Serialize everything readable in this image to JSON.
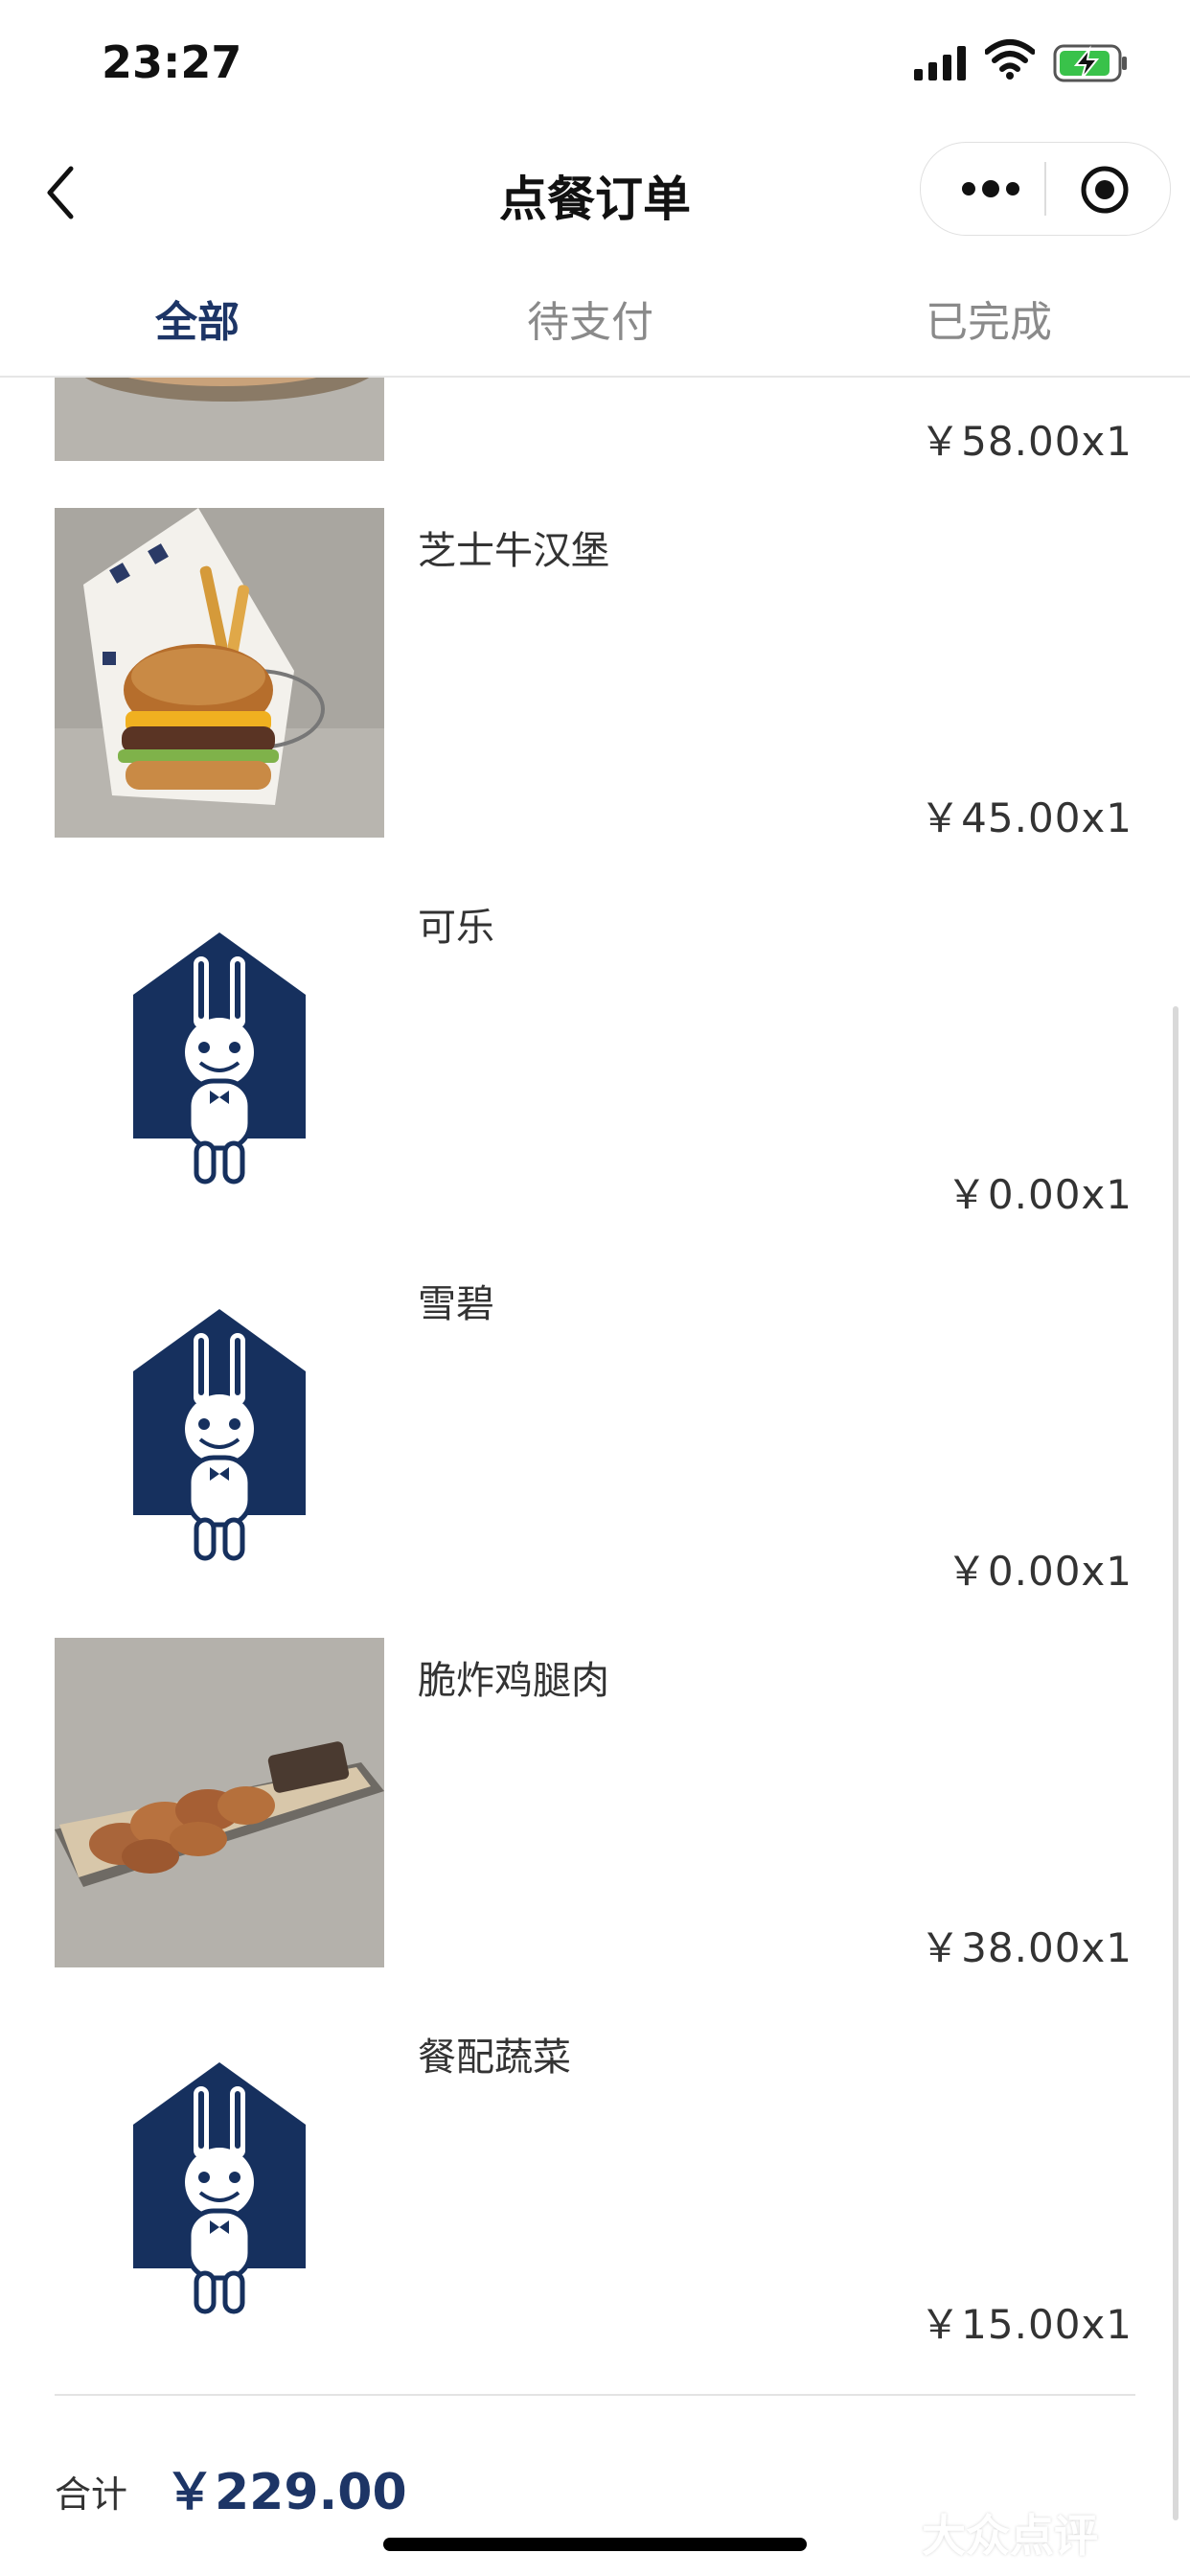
{
  "status_bar": {
    "time": "23:27"
  },
  "navbar": {
    "title": "点餐订单"
  },
  "tabs": [
    {
      "label": "全部",
      "active": true
    },
    {
      "label": "待支付",
      "active": false
    },
    {
      "label": "已完成",
      "active": false
    }
  ],
  "items": [
    {
      "name": "",
      "price": "￥58.00x1",
      "image": "food-photo-partial"
    },
    {
      "name": "芝士牛汉堡",
      "price": "￥45.00x1",
      "image": "burger-photo"
    },
    {
      "name": "可乐",
      "price": "￥0.00x1",
      "image": "rabbit-house-logo"
    },
    {
      "name": "雪碧",
      "price": "￥0.00x1",
      "image": "rabbit-house-logo"
    },
    {
      "name": "脆炸鸡腿肉",
      "price": "￥38.00x1",
      "image": "fried-chicken-photo"
    },
    {
      "name": "餐配蔬菜",
      "price": "￥15.00x1",
      "image": "rabbit-house-logo"
    }
  ],
  "footer": {
    "total_label": "合计",
    "total_value": "￥229.00"
  },
  "watermark": "大众点评",
  "colors": {
    "brand_navy": "#1d3566",
    "text": "#333333",
    "muted": "#8a8a8a"
  }
}
